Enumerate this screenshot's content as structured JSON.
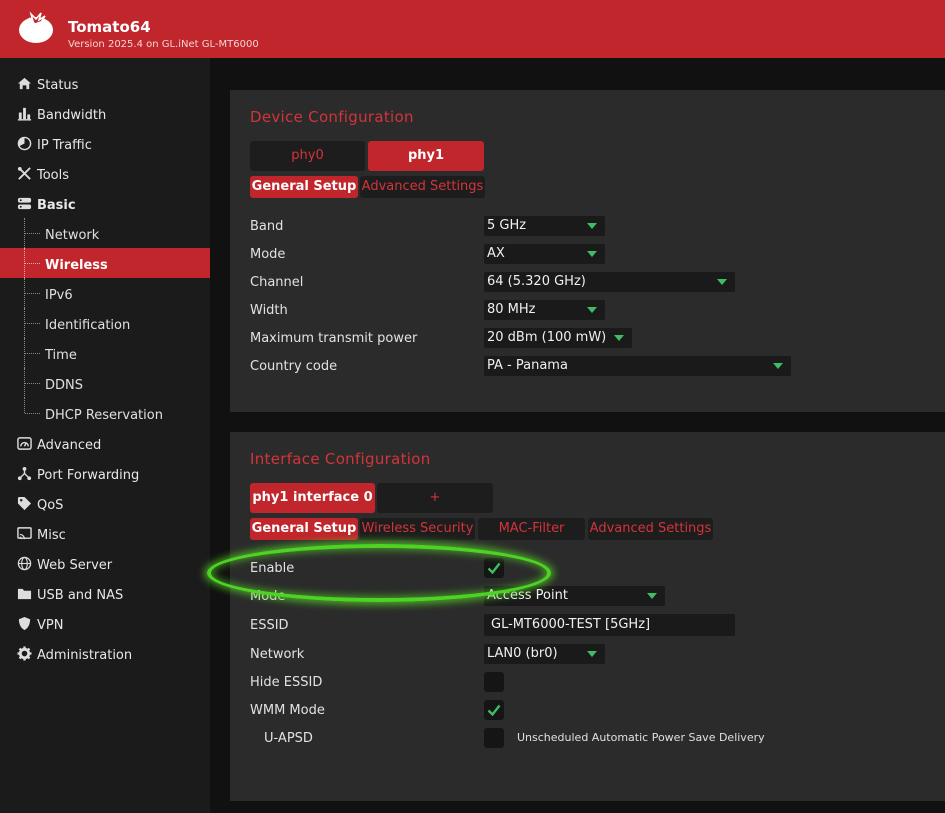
{
  "header": {
    "title": "Tomato64",
    "subtitle": "Version 2025.4 on GL.iNet GL-MT6000"
  },
  "sidebar": {
    "items": [
      {
        "label": "Status",
        "icon": "home-icon"
      },
      {
        "label": "Bandwidth",
        "icon": "bar-chart-icon"
      },
      {
        "label": "IP Traffic",
        "icon": "pie-chart-icon"
      },
      {
        "label": "Tools",
        "icon": "tools-icon"
      },
      {
        "label": "Basic",
        "icon": "server-icon"
      },
      {
        "label": "Advanced",
        "icon": "dashboard-icon"
      },
      {
        "label": "Port Forwarding",
        "icon": "network-icon"
      },
      {
        "label": "QoS",
        "icon": "tag-icon"
      },
      {
        "label": "Misc",
        "icon": "cast-icon"
      },
      {
        "label": "Web Server",
        "icon": "globe-icon"
      },
      {
        "label": "USB and NAS",
        "icon": "folder-icon"
      },
      {
        "label": "VPN",
        "icon": "shield-icon"
      },
      {
        "label": "Administration",
        "icon": "gear-icon"
      }
    ],
    "basic_sub": [
      "Network",
      "Wireless",
      "IPv6",
      "Identification",
      "Time",
      "DDNS",
      "DHCP Reservation"
    ],
    "active_sub": "Wireless"
  },
  "device": {
    "title": "Device Configuration",
    "phy_tabs": [
      "phy0",
      "phy1"
    ],
    "active_phy": "phy1",
    "sub_tabs": [
      "General Setup",
      "Advanced Settings"
    ],
    "active_sub_tab": "General Setup",
    "fields": {
      "band": {
        "label": "Band",
        "value": "5 GHz"
      },
      "mode": {
        "label": "Mode",
        "value": "AX"
      },
      "channel": {
        "label": "Channel",
        "value": "64 (5.320 GHz)"
      },
      "width": {
        "label": "Width",
        "value": "80 MHz"
      },
      "txpower": {
        "label": "Maximum transmit power",
        "value": "20 dBm (100 mW)"
      },
      "country": {
        "label": "Country code",
        "value": "PA - Panama"
      }
    }
  },
  "iface": {
    "title": "Interface Configuration",
    "tabs": [
      "phy1 interface 0",
      "+"
    ],
    "sub_tabs": [
      "General Setup",
      "Wireless Security",
      "MAC-Filter",
      "Advanced Settings"
    ],
    "active_sub_tab": "General Setup",
    "fields": {
      "enable": {
        "label": "Enable",
        "checked": true
      },
      "mode": {
        "label": "Mode",
        "value": "Access Point"
      },
      "essid": {
        "label": "ESSID",
        "value": "GL-MT6000-TEST [5GHz]"
      },
      "network": {
        "label": "Network",
        "value": "LAN0 (br0)"
      },
      "hide_essid": {
        "label": "Hide ESSID",
        "checked": false
      },
      "wmm": {
        "label": "WMM Mode",
        "checked": true
      },
      "uapsd": {
        "label": "U-APSD",
        "checked": false,
        "hint": "Unscheduled Automatic Power Save Delivery"
      }
    }
  },
  "colors": {
    "accent": "#c0262b",
    "check": "#3ebd63",
    "highlight": "#4dd324"
  }
}
